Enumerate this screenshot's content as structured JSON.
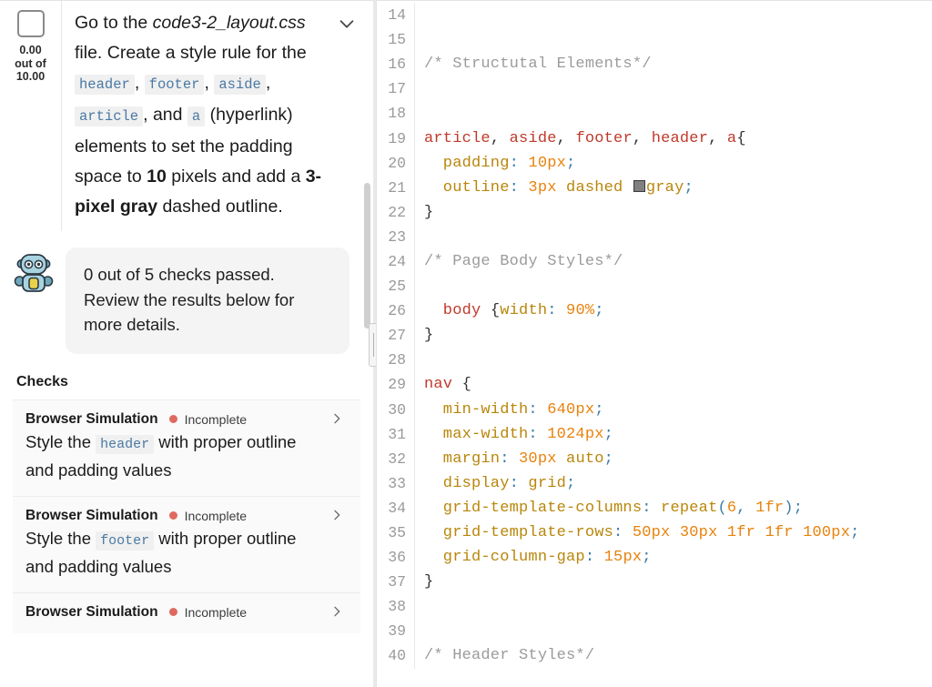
{
  "task": {
    "score": "0.00\nout of\n10.00",
    "score_value": "0.00",
    "score_outof_label": "out of",
    "score_max": "10.00",
    "collapse_icon": "chevron-down-icon",
    "text_parts": [
      {
        "type": "plain",
        "text": "Go to the "
      },
      {
        "type": "em",
        "text": "code3-2_layout.css"
      },
      {
        "type": "plain",
        "text": " file. Create a style rule for the "
      },
      {
        "type": "code",
        "text": "header"
      },
      {
        "type": "plain",
        "text": ", "
      },
      {
        "type": "code",
        "text": "footer"
      },
      {
        "type": "plain",
        "text": ", "
      },
      {
        "type": "code",
        "text": "aside"
      },
      {
        "type": "plain",
        "text": ", "
      },
      {
        "type": "code",
        "text": "article"
      },
      {
        "type": "plain",
        "text": ", and "
      },
      {
        "type": "code",
        "text": "a"
      },
      {
        "type": "plain",
        "text": " (hyperlink) elements to set the padding space to "
      },
      {
        "type": "b",
        "text": "10"
      },
      {
        "type": "plain",
        "text": " pixels and add a "
      },
      {
        "type": "b",
        "text": "3-pixel gray"
      },
      {
        "type": "plain",
        "text": " dashed outline."
      }
    ]
  },
  "feedback": {
    "avatar": "robot-avatar-icon",
    "message": "0 out of 5 checks passed. Review the results below for more details."
  },
  "checks_section": {
    "heading": "Checks",
    "items": [
      {
        "kind": "Browser Simulation",
        "status": "Incomplete",
        "status_color": "#e0695f",
        "expand_icon": "chevron-right-icon",
        "desc_parts": [
          {
            "type": "plain",
            "text": "Style the "
          },
          {
            "type": "code",
            "text": "header"
          },
          {
            "type": "plain",
            "text": " with proper outline and padding values"
          }
        ]
      },
      {
        "kind": "Browser Simulation",
        "status": "Incomplete",
        "status_color": "#e0695f",
        "expand_icon": "chevron-right-icon",
        "desc_parts": [
          {
            "type": "plain",
            "text": "Style the "
          },
          {
            "type": "code",
            "text": "footer"
          },
          {
            "type": "plain",
            "text": " with proper outline and padding values"
          }
        ]
      },
      {
        "kind": "Browser Simulation",
        "status": "Incomplete",
        "status_color": "#e0695f",
        "expand_icon": "chevron-right-icon",
        "desc_parts": []
      }
    ]
  },
  "splitter": {
    "name": "panel-splitter-handle"
  },
  "editor": {
    "first_line_number": 14,
    "lines": [
      {
        "n": 14,
        "tokens": []
      },
      {
        "n": 15,
        "tokens": []
      },
      {
        "n": 16,
        "tokens": [
          {
            "c": "t-com",
            "t": "/* Structutal Elements*/"
          }
        ]
      },
      {
        "n": 17,
        "tokens": []
      },
      {
        "n": 18,
        "tokens": []
      },
      {
        "n": 19,
        "tokens": [
          {
            "c": "t-sel",
            "t": "article"
          },
          {
            "c": "t-plain",
            "t": ", "
          },
          {
            "c": "t-sel",
            "t": "aside"
          },
          {
            "c": "t-plain",
            "t": ", "
          },
          {
            "c": "t-sel",
            "t": "footer"
          },
          {
            "c": "t-plain",
            "t": ", "
          },
          {
            "c": "t-sel",
            "t": "header"
          },
          {
            "c": "t-plain",
            "t": ", "
          },
          {
            "c": "t-sel",
            "t": "a"
          },
          {
            "c": "t-plain",
            "t": "{"
          }
        ]
      },
      {
        "n": 20,
        "tokens": [
          {
            "c": "t-prop",
            "t": "  padding"
          },
          {
            "c": "t-pun",
            "t": ":"
          },
          {
            "c": "t-val",
            "t": " 10px"
          },
          {
            "c": "t-pun",
            "t": ";"
          }
        ]
      },
      {
        "n": 21,
        "tokens": [
          {
            "c": "t-prop",
            "t": "  outline"
          },
          {
            "c": "t-pun",
            "t": ":"
          },
          {
            "c": "t-val",
            "t": " 3px"
          },
          {
            "c": "t-prop",
            "t": " dashed "
          },
          {
            "c": "swatch",
            "t": ""
          },
          {
            "c": "t-prop",
            "t": "gray"
          },
          {
            "c": "t-pun",
            "t": ";"
          }
        ]
      },
      {
        "n": 22,
        "tokens": [
          {
            "c": "t-plain",
            "t": "}"
          }
        ]
      },
      {
        "n": 23,
        "tokens": []
      },
      {
        "n": 24,
        "tokens": [
          {
            "c": "t-com",
            "t": "/* Page Body Styles*/"
          }
        ]
      },
      {
        "n": 25,
        "tokens": []
      },
      {
        "n": 26,
        "tokens": [
          {
            "c": "t-sel",
            "t": "  body"
          },
          {
            "c": "t-plain",
            "t": " {"
          },
          {
            "c": "t-prop",
            "t": "width"
          },
          {
            "c": "t-pun",
            "t": ":"
          },
          {
            "c": "t-val",
            "t": " 90%"
          },
          {
            "c": "t-pun",
            "t": ";"
          }
        ]
      },
      {
        "n": 27,
        "tokens": [
          {
            "c": "t-plain",
            "t": "}"
          }
        ]
      },
      {
        "n": 28,
        "tokens": []
      },
      {
        "n": 29,
        "tokens": [
          {
            "c": "t-sel",
            "t": "nav"
          },
          {
            "c": "t-plain",
            "t": " {"
          }
        ]
      },
      {
        "n": 30,
        "tokens": [
          {
            "c": "t-prop",
            "t": "  min-width"
          },
          {
            "c": "t-pun",
            "t": ":"
          },
          {
            "c": "t-val",
            "t": " 640px"
          },
          {
            "c": "t-pun",
            "t": ";"
          }
        ]
      },
      {
        "n": 31,
        "tokens": [
          {
            "c": "t-prop",
            "t": "  max-width"
          },
          {
            "c": "t-pun",
            "t": ":"
          },
          {
            "c": "t-val",
            "t": " 1024px"
          },
          {
            "c": "t-pun",
            "t": ";"
          }
        ]
      },
      {
        "n": 32,
        "tokens": [
          {
            "c": "t-prop",
            "t": "  margin"
          },
          {
            "c": "t-pun",
            "t": ":"
          },
          {
            "c": "t-val",
            "t": " 30px"
          },
          {
            "c": "t-prop",
            "t": " auto"
          },
          {
            "c": "t-pun",
            "t": ";"
          }
        ]
      },
      {
        "n": 33,
        "tokens": [
          {
            "c": "t-prop",
            "t": "  display"
          },
          {
            "c": "t-pun",
            "t": ":"
          },
          {
            "c": "t-prop",
            "t": " grid"
          },
          {
            "c": "t-pun",
            "t": ";"
          }
        ]
      },
      {
        "n": 34,
        "tokens": [
          {
            "c": "t-prop",
            "t": "  grid-template-columns"
          },
          {
            "c": "t-pun",
            "t": ":"
          },
          {
            "c": "t-prop",
            "t": " repeat"
          },
          {
            "c": "t-pun",
            "t": "("
          },
          {
            "c": "t-val",
            "t": "6"
          },
          {
            "c": "t-pun",
            "t": ","
          },
          {
            "c": "t-val",
            "t": " 1fr"
          },
          {
            "c": "t-pun",
            "t": ");"
          }
        ]
      },
      {
        "n": 35,
        "tokens": [
          {
            "c": "t-prop",
            "t": "  grid-template-rows"
          },
          {
            "c": "t-pun",
            "t": ":"
          },
          {
            "c": "t-val",
            "t": " 50px 30px 1fr 1fr 100px"
          },
          {
            "c": "t-pun",
            "t": ";"
          }
        ]
      },
      {
        "n": 36,
        "tokens": [
          {
            "c": "t-prop",
            "t": "  grid-column-gap"
          },
          {
            "c": "t-pun",
            "t": ":"
          },
          {
            "c": "t-val",
            "t": " 15px"
          },
          {
            "c": "t-pun",
            "t": ";"
          }
        ]
      },
      {
        "n": 37,
        "tokens": [
          {
            "c": "t-plain",
            "t": "}"
          }
        ]
      },
      {
        "n": 38,
        "tokens": []
      },
      {
        "n": 39,
        "tokens": []
      },
      {
        "n": 40,
        "tokens": [
          {
            "c": "t-com",
            "t": "/* Header Styles*/"
          }
        ]
      }
    ]
  }
}
